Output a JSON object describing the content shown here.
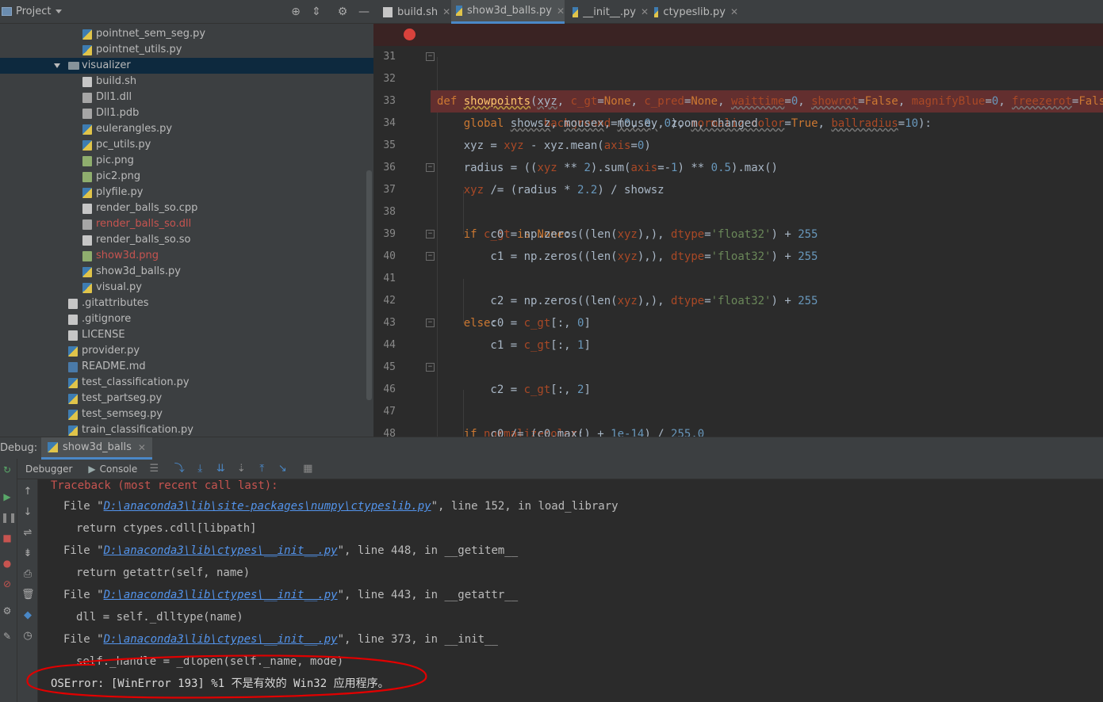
{
  "project": {
    "title": "Project",
    "files": [
      {
        "name": "pointnet_sem_seg.py",
        "type": "py",
        "color": "normal"
      },
      {
        "name": "pointnet_utils.py",
        "type": "py",
        "color": "normal"
      },
      {
        "name": "visualizer",
        "type": "folder",
        "color": "normal"
      },
      {
        "name": "build.sh",
        "type": "text",
        "color": "normal"
      },
      {
        "name": "Dll1.dll",
        "type": "dll",
        "color": "normal"
      },
      {
        "name": "Dll1.pdb",
        "type": "dll",
        "color": "normal"
      },
      {
        "name": "eulerangles.py",
        "type": "py",
        "color": "normal"
      },
      {
        "name": "pc_utils.py",
        "type": "py",
        "color": "normal"
      },
      {
        "name": "pic.png",
        "type": "img",
        "color": "normal"
      },
      {
        "name": "pic2.png",
        "type": "img",
        "color": "normal"
      },
      {
        "name": "plyfile.py",
        "type": "py",
        "color": "normal"
      },
      {
        "name": "render_balls_so.cpp",
        "type": "text",
        "color": "normal"
      },
      {
        "name": "render_balls_so.dll",
        "type": "dll",
        "color": "red"
      },
      {
        "name": "render_balls_so.so",
        "type": "text",
        "color": "normal"
      },
      {
        "name": "show3d.png",
        "type": "img",
        "color": "red"
      },
      {
        "name": "show3d_balls.py",
        "type": "py",
        "color": "normal"
      },
      {
        "name": "visual.py",
        "type": "py",
        "color": "normal"
      },
      {
        "name": ".gitattributes",
        "type": "text",
        "color": "normal"
      },
      {
        "name": ".gitignore",
        "type": "text",
        "color": "normal"
      },
      {
        "name": "LICENSE",
        "type": "text",
        "color": "normal"
      },
      {
        "name": "provider.py",
        "type": "py",
        "color": "normal"
      },
      {
        "name": "README.md",
        "type": "md",
        "color": "normal"
      },
      {
        "name": "test_classification.py",
        "type": "py",
        "color": "normal"
      },
      {
        "name": "test_partseg.py",
        "type": "py",
        "color": "normal"
      },
      {
        "name": "test_semseg.py",
        "type": "py",
        "color": "normal"
      },
      {
        "name": "train_classification.py",
        "type": "py",
        "color": "normal"
      }
    ]
  },
  "editor": {
    "tabs": [
      {
        "label": "build.sh",
        "active": false
      },
      {
        "label": "show3d_balls.py",
        "active": true
      },
      {
        "label": "__init__.py",
        "active": false
      },
      {
        "label": "ctypeslib.py",
        "active": false
      }
    ],
    "line_numbers": [
      "31",
      "32",
      "33",
      "34",
      "35",
      "36",
      "37",
      "38",
      "39",
      "40",
      "41",
      "42",
      "43",
      "44",
      "45",
      "46",
      "47",
      "48"
    ]
  },
  "debug": {
    "label": "Debug:",
    "session": "show3d_balls",
    "debugger_tab": "Debugger",
    "console_tab": "Console",
    "console": {
      "traceback_head": "Traceback (most recent call last):",
      "frames": [
        {
          "prefix": "File \"",
          "path": "D:\\anaconda3\\lib\\site-packages\\numpy\\ctypeslib.py",
          "suffix": "\", line 152, in load_library",
          "code": "return ctypes.cdll[libpath]"
        },
        {
          "prefix": "File \"",
          "path": "D:\\anaconda3\\lib\\ctypes\\__init__.py",
          "suffix": "\", line 448, in __getitem__",
          "code": "return getattr(self, name)"
        },
        {
          "prefix": "File \"",
          "path": "D:\\anaconda3\\lib\\ctypes\\__init__.py",
          "suffix": "\", line 443, in __getattr__",
          "code": "dll = self._dlltype(name)"
        },
        {
          "prefix": "File \"",
          "path": "D:\\anaconda3\\lib\\ctypes\\__init__.py",
          "suffix": "\", line 373, in __init__",
          "code": "self._handle = _dlopen(self._name, mode)"
        }
      ],
      "error": "OSError: [WinError 193] %1 不是有效的 Win32 应用程序。"
    }
  },
  "colors": {
    "panel_bg": "#3c3f41",
    "editor_bg": "#2b2b2b",
    "selection": "#0d293e",
    "breakpoint": "#d9423c",
    "accent": "#4a88c7",
    "link": "#5394ec",
    "annotation_red": "#e00000"
  }
}
